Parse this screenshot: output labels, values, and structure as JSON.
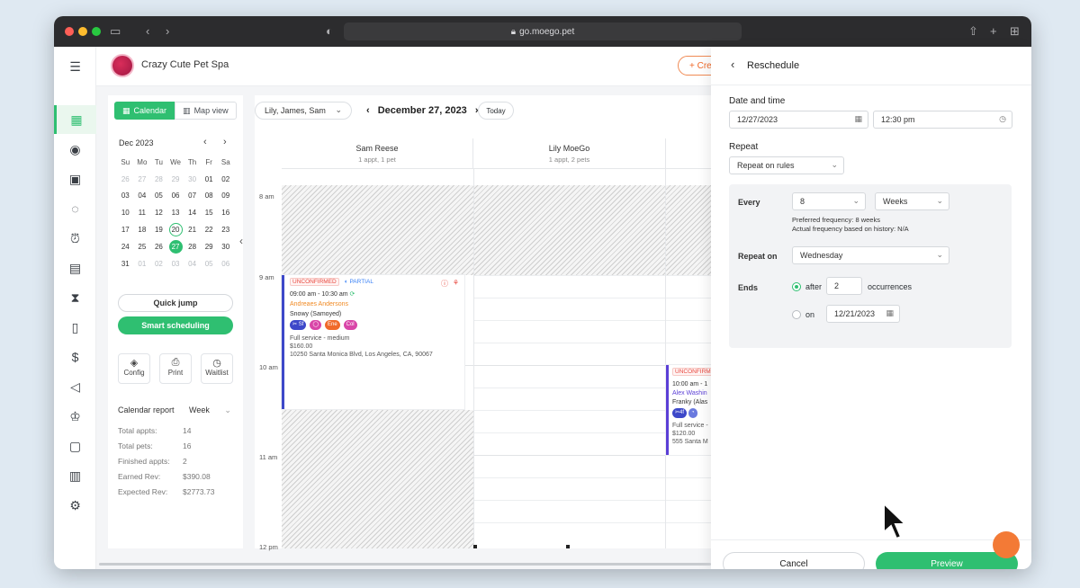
{
  "browser": {
    "url": "go.moego.pet"
  },
  "header": {
    "business_name": "Crazy Cute Pet Spa",
    "create_label": "+ Cre"
  },
  "sidebar": {
    "view_calendar": "Calendar",
    "view_map": "Map view",
    "month": "Dec 2023",
    "weekdays": [
      "Su",
      "Mo",
      "Tu",
      "We",
      "Th",
      "Fr",
      "Sa"
    ],
    "weeks": [
      [
        "26",
        "27",
        "28",
        "29",
        "30",
        "01",
        "02"
      ],
      [
        "03",
        "04",
        "05",
        "06",
        "07",
        "08",
        "09"
      ],
      [
        "10",
        "11",
        "12",
        "13",
        "14",
        "15",
        "16"
      ],
      [
        "17",
        "18",
        "19",
        "20",
        "21",
        "22",
        "23"
      ],
      [
        "24",
        "25",
        "26",
        "27",
        "28",
        "29",
        "30"
      ],
      [
        "31",
        "01",
        "02",
        "03",
        "04",
        "05",
        "06"
      ]
    ],
    "quick_jump": "Quick jump",
    "smart_scheduling": "Smart scheduling",
    "tools": [
      "Config",
      "Print",
      "Waitlist"
    ],
    "report_label": "Calendar report",
    "report_period": "Week",
    "stats": [
      {
        "k": "Total appts:",
        "v": "14"
      },
      {
        "k": "Total pets:",
        "v": "16"
      },
      {
        "k": "Finished appts:",
        "v": "2"
      },
      {
        "k": "Earned Rev:",
        "v": "$390.08"
      },
      {
        "k": "Expected Rev:",
        "v": "$2773.73"
      }
    ]
  },
  "calendar": {
    "staff_filter": "Lily, James, Sam",
    "date": "December 27, 2023",
    "today": "Today",
    "columns": [
      {
        "name": "Sam Reese",
        "sub": "1 appt, 1 pet"
      },
      {
        "name": "Lily MoeGo",
        "sub": "1 appt, 2 pets"
      }
    ],
    "times": [
      "8 am",
      "9 am",
      "10 am",
      "11 am",
      "12 pm"
    ],
    "appt1": {
      "status": "UNCONFIRMED",
      "payment": "PARTIAL",
      "time": "09:00 am - 10:30 am",
      "client": "Andreaes Andersons",
      "pet": "Snowy (Samoyed)",
      "pills": [
        "Sf",
        "",
        "Ene",
        "Col"
      ],
      "service": "Full service - medium",
      "price": "$160.00",
      "address": "10250 Santa Monica Blvd, Los Angeles, CA, 90067"
    },
    "appt2": {
      "status": "UNCONFIRMED",
      "time": "10:00 am - 1",
      "client": "Alex Washin",
      "pet": "Franky (Alas",
      "pills": [
        "4f",
        ""
      ],
      "service": "Full service -",
      "price": "$120.00",
      "address": "555 Santa M"
    }
  },
  "panel": {
    "title": "Reschedule",
    "date_time_label": "Date and time",
    "date": "12/27/2023",
    "time": "12:30 pm",
    "repeat_label": "Repeat",
    "repeat_mode": "Repeat on rules",
    "every_label": "Every",
    "every_value": "8",
    "every_unit": "Weeks",
    "pref_freq": "Preferred frequency: 8 weeks",
    "actual_freq": "Actual frequency based on history: N/A",
    "repeat_on_label": "Repeat on",
    "repeat_on_value": "Wednesday",
    "ends_label": "Ends",
    "after_label": "after",
    "after_value": "2",
    "occurrences_label": "occurrences",
    "on_label": "on",
    "on_date": "12/21/2023",
    "cancel": "Cancel",
    "preview": "Preview"
  },
  "colors": {
    "accent": "#2fbf71",
    "brand_orange": "#f37a36",
    "unconfirmed": "#e8483f"
  }
}
